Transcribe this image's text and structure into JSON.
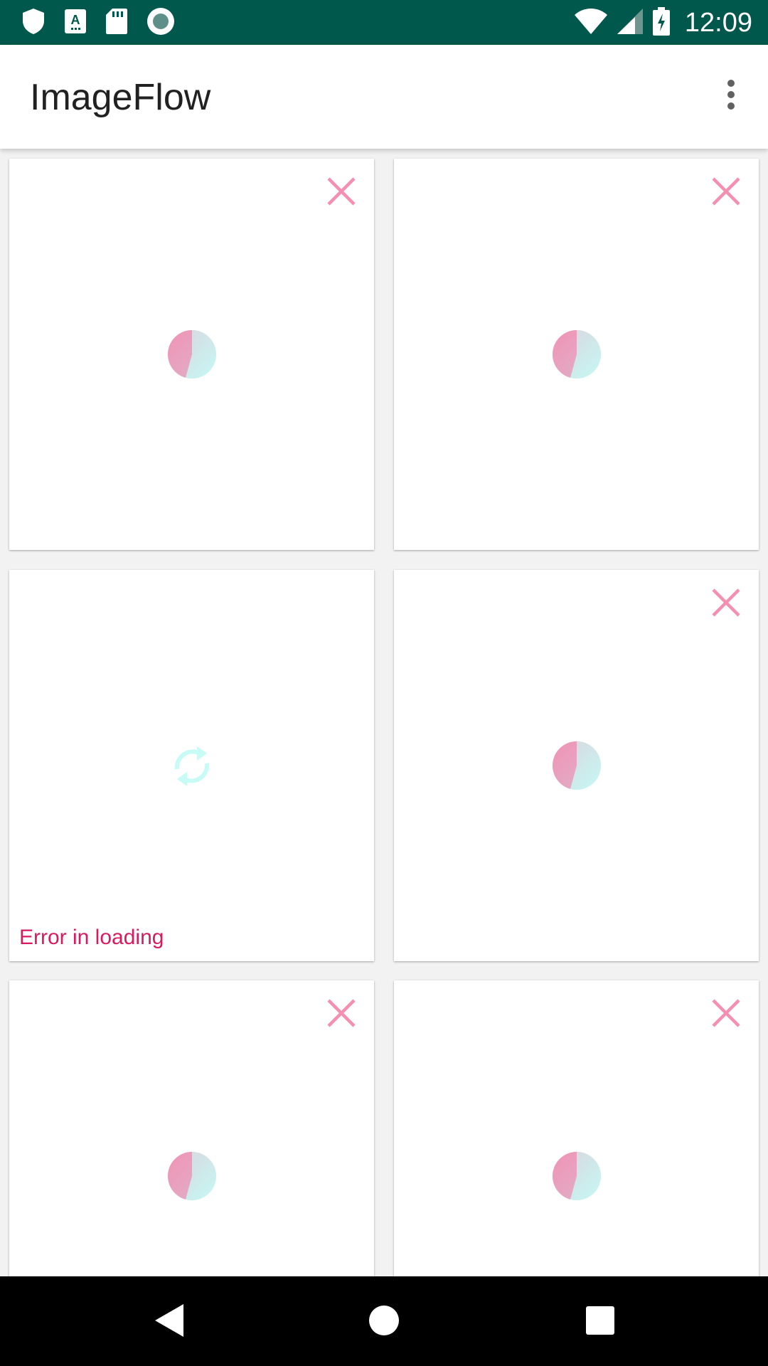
{
  "status_bar": {
    "time": "12:09",
    "left_icons": [
      "shield-icon",
      "a-notification-icon",
      "sd-card-icon",
      "radio-button-icon"
    ],
    "right_icons": [
      "wifi-icon",
      "cell-signal-icon",
      "battery-charging-icon"
    ]
  },
  "app_bar": {
    "title": "ImageFlow",
    "overflow_icon": "more-vert-icon"
  },
  "grid": {
    "cards": [
      {
        "state": "loading",
        "close_icon": "close-icon"
      },
      {
        "state": "loading",
        "close_icon": "close-icon"
      },
      {
        "state": "error",
        "error_text": "Error in loading",
        "retry_icon": "refresh-icon"
      },
      {
        "state": "loading",
        "close_icon": "close-icon"
      },
      {
        "state": "loading",
        "close_icon": "close-icon"
      },
      {
        "state": "loading",
        "close_icon": "close-icon"
      }
    ]
  },
  "nav_bar": {
    "icons": [
      "back-icon",
      "home-icon",
      "recents-icon"
    ]
  },
  "colors": {
    "status_bar": "#00574b",
    "accent_pink": "#f48fb1",
    "error_text": "#d81b60",
    "spinner_cyan": "#c6fbf6"
  }
}
